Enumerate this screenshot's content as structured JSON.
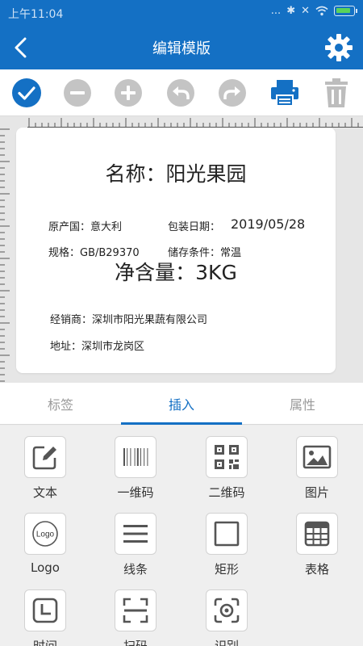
{
  "status_bar": {
    "time": "上午11:04",
    "signal_dots": "...",
    "bluetooth": "✱",
    "mute": "✕"
  },
  "header": {
    "title": "编辑模版"
  },
  "toolbar": {
    "icons": [
      "check-icon",
      "minus-icon",
      "plus-icon",
      "undo-icon",
      "redo-icon",
      "print-icon",
      "trash-icon"
    ],
    "accent": "#1470c4",
    "disabled": "#bdbdbd"
  },
  "label": {
    "title": "名称：阳光果园",
    "origin": "原产国：意大利",
    "pack_date_label": "包装日期：",
    "pack_date": "2019/05/28",
    "spec": "规格：GB/B29370",
    "storage": "储存条件：常温",
    "net": "净含量：3KG",
    "dealer": "经销商：深圳市阳光果蔬有限公司",
    "address": "地址：深圳市龙岗区"
  },
  "tabs": [
    {
      "label": "标签"
    },
    {
      "label": "插入"
    },
    {
      "label": "属性"
    }
  ],
  "insert_items": [
    {
      "label": "文本",
      "icon": "text-edit-icon"
    },
    {
      "label": "一维码",
      "icon": "barcode-icon"
    },
    {
      "label": "二维码",
      "icon": "qrcode-icon"
    },
    {
      "label": "图片",
      "icon": "image-icon"
    },
    {
      "label": "Logo",
      "icon": "logo-icon"
    },
    {
      "label": "线条",
      "icon": "lines-icon"
    },
    {
      "label": "矩形",
      "icon": "rectangle-icon"
    },
    {
      "label": "表格",
      "icon": "table-icon"
    },
    {
      "label": "时间",
      "icon": "clock-icon"
    },
    {
      "label": "扫码",
      "icon": "scan-icon"
    },
    {
      "label": "识别",
      "icon": "recognize-icon"
    }
  ]
}
